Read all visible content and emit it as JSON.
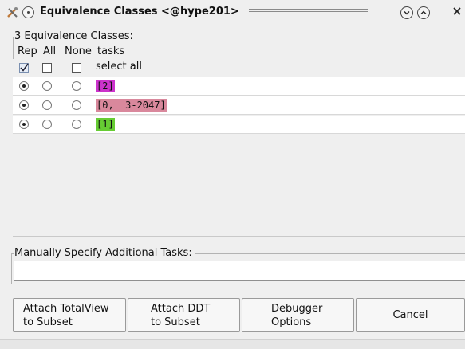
{
  "window": {
    "title": "Equivalence Classes <@hype201>"
  },
  "classes_frame": {
    "legend": "3 Equivalence Classes:"
  },
  "table": {
    "headers": {
      "rep": "Rep",
      "all": "All",
      "none": "None",
      "tasks": "tasks"
    },
    "select_all_label": "select all",
    "select_all_checked": {
      "rep": true,
      "all": false,
      "none": false
    },
    "rows": [
      {
        "rep": true,
        "all": false,
        "none": false,
        "task": "[2]",
        "color": "#cc33cc"
      },
      {
        "rep": true,
        "all": false,
        "none": false,
        "task": "[0,  3-2047]",
        "color": "#d9889c"
      },
      {
        "rep": true,
        "all": false,
        "none": false,
        "task": "[1]",
        "color": "#66cc33"
      }
    ]
  },
  "manual": {
    "legend": "Manually Specify Additional Tasks:",
    "value": ""
  },
  "buttons": {
    "attach_totalview": {
      "line1": "Attach TotalView",
      "line2": "to Subset"
    },
    "attach_ddt": {
      "line1": "Attach DDT",
      "line2": "to Subset"
    },
    "debugger_options": {
      "line1": "Debugger",
      "line2": "Options"
    },
    "cancel": "Cancel"
  },
  "icons": {
    "tools": "tools-icon",
    "menu": "window-menu-icon",
    "minimize": "minimize-icon",
    "maximize": "maximize-icon",
    "close": "close-icon"
  }
}
